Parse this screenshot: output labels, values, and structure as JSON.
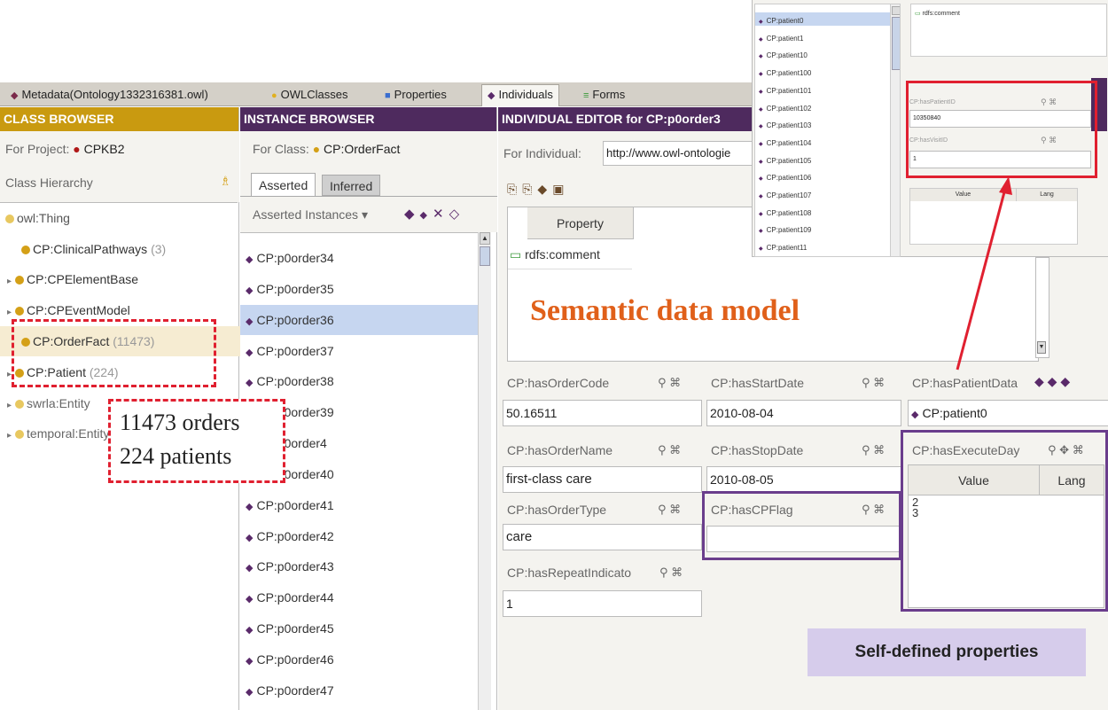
{
  "tabs": [
    {
      "icon": "◆",
      "label": "Metadata(Ontology1332316381.owl)",
      "active": false
    },
    {
      "icon": "●",
      "label": "OWLClasses",
      "active": false
    },
    {
      "icon": "■",
      "label": "Properties",
      "active": false
    },
    {
      "icon": "◆",
      "label": "Individuals",
      "active": true
    },
    {
      "icon": "≡",
      "label": "Forms",
      "active": false
    }
  ],
  "class_browser": {
    "title": "CLASS BROWSER",
    "for_project_label": "For Project:",
    "project": "CPKB2",
    "hierarchy_label": "Class Hierarchy",
    "items": [
      {
        "label": "owl:Thing",
        "count": ""
      },
      {
        "label": "CP:ClinicalPathways",
        "count": "(3)"
      },
      {
        "label": "CP:CPElementBase",
        "count": ""
      },
      {
        "label": "CP:CPEventModel",
        "count": ""
      },
      {
        "label": "CP:OrderFact",
        "count": "(11473)"
      },
      {
        "label": "CP:Patient",
        "count": "(224)"
      },
      {
        "label": "swrla:Entity",
        "count": ""
      },
      {
        "label": "temporal:Entity",
        "count": ""
      }
    ]
  },
  "instance_browser": {
    "title": "INSTANCE BROWSER",
    "for_class_label": "For Class:",
    "class": "CP:OrderFact",
    "tabs": [
      "Asserted",
      "Inferred"
    ],
    "section": "Asserted Instances ▾",
    "items": [
      "CP:p0order34",
      "CP:p0order35",
      "CP:p0order36",
      "CP:p0order37",
      "CP:p0order38",
      "CP:p0order39",
      "CP:p0order4",
      "CP:p0order40",
      "CP:p0order41",
      "CP:p0order42",
      "CP:p0order43",
      "CP:p0order44",
      "CP:p0order45",
      "CP:p0order46",
      "CP:p0order47"
    ]
  },
  "editor": {
    "title": "INDIVIDUAL EDITOR for CP:p0order3",
    "for_individual_label": "For Individual:",
    "individual_uri": "http://www.owl-ontologie",
    "property_col": "Property",
    "property_row": "rdfs:comment",
    "fields": {
      "order_code": {
        "label": "CP:hasOrderCode",
        "value": "50.16511"
      },
      "order_name": {
        "label": "CP:hasOrderName",
        "value": "first-class care"
      },
      "order_type": {
        "label": "CP:hasOrderType",
        "value": "care"
      },
      "repeat": {
        "label": "CP:hasRepeatIndicato",
        "value": "1"
      },
      "start": {
        "label": "CP:hasStartDate",
        "value": "2010-08-04"
      },
      "stop": {
        "label": "CP:hasStopDate",
        "value": "2010-08-05"
      },
      "cpflag": {
        "label": "CP:hasCPFlag",
        "value": ""
      },
      "patient": {
        "label": "CP:hasPatientData",
        "value": "CP:patient0"
      },
      "execute": {
        "label": "CP:hasExecuteDay",
        "col_value": "Value",
        "col_lang": "Lang",
        "rows": [
          "2",
          "3"
        ]
      }
    }
  },
  "popup_list": [
    "CP:patient0",
    "CP:patient1",
    "CP:patient10",
    "CP:patient100",
    "CP:patient101",
    "CP:patient102",
    "CP:patient103",
    "CP:patient104",
    "CP:patient105",
    "CP:patient106",
    "CP:patient107",
    "CP:patient108",
    "CP:patient109",
    "CP:patient11"
  ],
  "popup_props": {
    "comment": "rdfs:comment",
    "patient_id_label": "CP:hasPatientID",
    "patient_id": "10350840",
    "visit_id_label": "CP:hasVisitID",
    "visit_id": "1",
    "value_col": "Value",
    "lang_col": "Lang"
  },
  "annotations": {
    "counts_line1": "11473 orders",
    "counts_line2": "224 patients",
    "semantic": "Semantic data model",
    "self_defined": "Self-defined properties"
  },
  "colors": {
    "class_header": "#c99a10",
    "instance_header": "#4e2a5e",
    "editor_header": "#4e2a5e",
    "red_annot": "#e02030",
    "purple_annot": "#6a3d8c",
    "orange_text": "#e0601a",
    "highlight": "#c6d6f0"
  }
}
